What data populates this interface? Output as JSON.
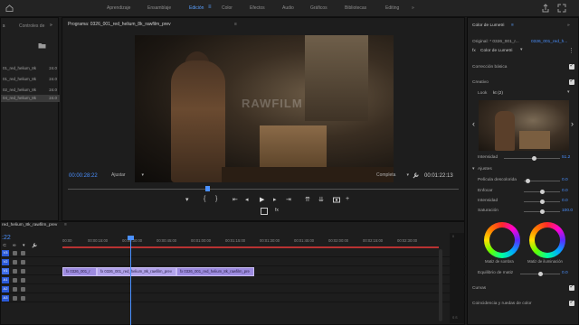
{
  "workspaces": {
    "items": [
      "Aprendizaje",
      "Ensamblaje",
      "Edición",
      "Color",
      "Efectos",
      "Audio",
      "Gráficos",
      "Bibliotecas",
      "Editing"
    ],
    "active": "Edición",
    "menu_glyph": "≡",
    "more_glyph": "»"
  },
  "project": {
    "tab_partial": "s",
    "tab_controls": "Controles de",
    "rows": [
      {
        "name": "01_red_helium_8k",
        "rate": "24.0"
      },
      {
        "name": "01_red_helium_8k",
        "rate": "24.0"
      },
      {
        "name": "02_red_helium_8k",
        "rate": "24.0"
      },
      {
        "name": "04_red_helium_8k",
        "rate": "24.0"
      }
    ]
  },
  "program": {
    "title": "Programa: 0326_001_red_helium_8k_rawfilm_prev",
    "menu_glyph": "≡",
    "watermark": "RAWFILM",
    "timecode_current": "00:00:28:22",
    "fit_label": "Ajustar",
    "resolution_label": "Completa",
    "timecode_duration": "00:01:22:13"
  },
  "lumetri": {
    "tab": "Color de Lumetri",
    "source_label": "Original: * 0326_001_r...",
    "source_value": "0326_001_red_h...",
    "fx_label": "fx",
    "effect_name": "Color de Lumetri",
    "sections": {
      "basic": "Corrección básica",
      "creative": "Creativo",
      "curves": "Curvas",
      "match": "Coincidencia y ruedas de color"
    },
    "look_label": "Look",
    "look_value": "kt (2)",
    "intensity_label": "Intensidad",
    "intensity_value": "51.2",
    "adjust_label": "Ajustes",
    "sliders": [
      {
        "label": "Película descolorida",
        "value": "0.0",
        "pos": 0.05
      },
      {
        "label": "Enfocar",
        "value": "0.0",
        "pos": 0.5
      },
      {
        "label": "Intensidad",
        "value": "0.0",
        "pos": 0.5
      },
      {
        "label": "Saturación",
        "value": "100.0",
        "pos": 0.5
      }
    ],
    "wheel_shadow": "Matiz de sombra",
    "wheel_highlight": "Matiz de iluminación",
    "balance_label": "Equilibrio de matiz",
    "balance_value": "0.0"
  },
  "timeline": {
    "title": "red_helium_8k_rawfilm_prev",
    "menu_glyph": "≡",
    "timecode": ":22",
    "ruler_ticks": [
      "00:00",
      "00:00:15:00",
      "00:00:30:00",
      "00:00:45:00",
      "00:01:00:00",
      "00:01:15:00",
      "00:01:30:00",
      "00:01:45:00",
      "00:02:00:00",
      "00:02:15:00",
      "00:02:30:00"
    ],
    "tracks": [
      "V3",
      "V2",
      "V1",
      "A1",
      "A2",
      "A3"
    ],
    "clips": [
      {
        "label": "fx  0326_001_r"
      },
      {
        "label": "fx  0326_001_red_helium_8k_rawfilm_prev"
      },
      {
        "label": "fx  0326_001_red_helium_8k_rawfilm_pre"
      }
    ],
    "meter_top": "0",
    "meter_bottom": "S S"
  },
  "colors": {
    "accent": "#4a90ff",
    "clip": "#9d8be0",
    "in_out_bar": "#b83232"
  }
}
